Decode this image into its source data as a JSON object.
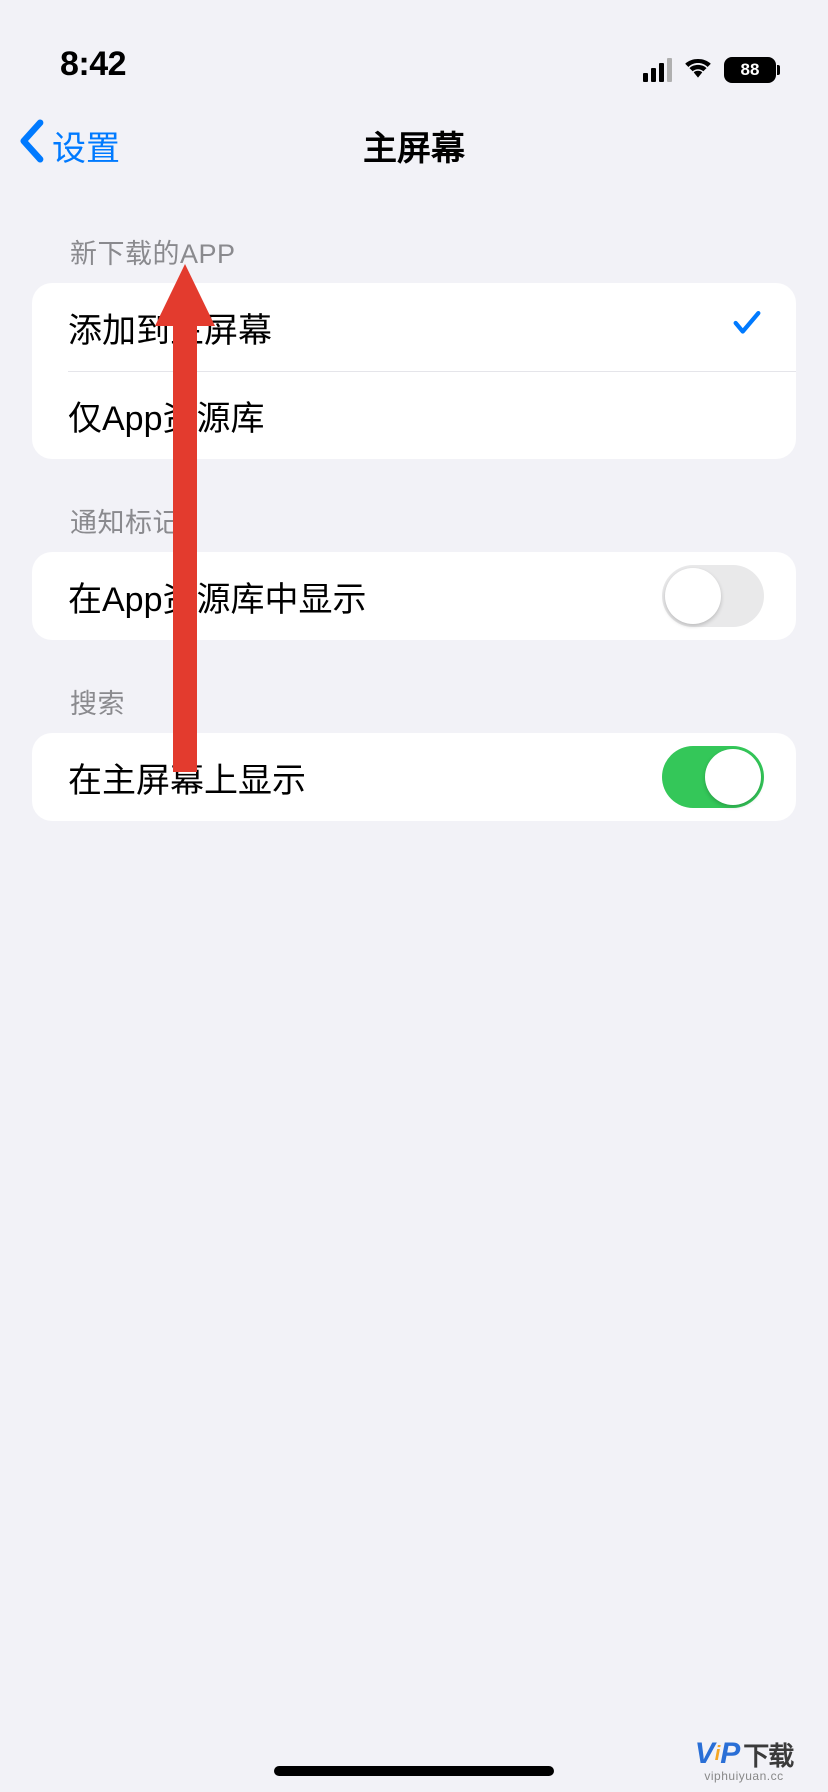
{
  "status": {
    "time": "8:42",
    "battery": "88"
  },
  "nav": {
    "back": "设置",
    "title": "主屏幕"
  },
  "section1": {
    "header": "新下载的APP",
    "option1": "添加到主屏幕",
    "option2": "仅App资源库"
  },
  "section2": {
    "header": "通知标记",
    "row1": "在App资源库中显示"
  },
  "section3": {
    "header": "搜索",
    "row1": "在主屏幕上显示"
  },
  "watermark": {
    "brand_v": "V",
    "brand_p": "P",
    "cn": "下载",
    "sub": "viphuiyuan.cc"
  }
}
